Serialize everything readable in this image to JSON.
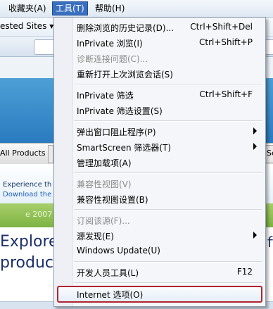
{
  "menubar": {
    "items": [
      {
        "label": "收藏夹(A)"
      },
      {
        "label": "工具(T)"
      },
      {
        "label": "帮助(H)"
      }
    ]
  },
  "background": {
    "favorites_text": "ested Sites ▾",
    "nav_all_products": "All Products",
    "nav_se": "Se",
    "experience_text": "Experience th",
    "download_text": "Download the fr",
    "year_text": "e 2007",
    "explore_text": "Explore",
    "product_text": "produc",
    "right_text": "ft"
  },
  "menu": {
    "items": [
      {
        "label": "删除浏览的历史记录(D)...",
        "shortcut": "Ctrl+Shift+Del",
        "disabled": false,
        "submenu": false
      },
      {
        "label": "InPrivate 浏览(I)",
        "shortcut": "Ctrl+Shift+P",
        "disabled": false,
        "submenu": false
      },
      {
        "label": "诊断连接问题(C)...",
        "shortcut": "",
        "disabled": true,
        "submenu": false
      },
      {
        "label": "重新打开上次浏览会话(S)",
        "shortcut": "",
        "disabled": false,
        "submenu": false
      },
      {
        "label": "InPrivate 筛选",
        "shortcut": "Ctrl+Shift+F",
        "disabled": false,
        "submenu": false
      },
      {
        "label": "InPrivate 筛选设置(S)",
        "shortcut": "",
        "disabled": false,
        "submenu": false
      },
      {
        "label": "弹出窗口阻止程序(P)",
        "shortcut": "",
        "disabled": false,
        "submenu": true
      },
      {
        "label": "SmartScreen 筛选器(T)",
        "shortcut": "",
        "disabled": false,
        "submenu": true
      },
      {
        "label": "管理加载项(A)",
        "shortcut": "",
        "disabled": false,
        "submenu": false
      },
      {
        "label": "兼容性视图(V)",
        "shortcut": "",
        "disabled": true,
        "submenu": false
      },
      {
        "label": "兼容性视图设置(B)",
        "shortcut": "",
        "disabled": false,
        "submenu": false
      },
      {
        "label": "订阅该源(F)...",
        "shortcut": "",
        "disabled": true,
        "submenu": false
      },
      {
        "label": "源发现(E)",
        "shortcut": "",
        "disabled": false,
        "submenu": true
      },
      {
        "label": "Windows Update(U)",
        "shortcut": "",
        "disabled": false,
        "submenu": false
      },
      {
        "label": "开发人员工具(L)",
        "shortcut": "F12",
        "disabled": false,
        "submenu": false
      },
      {
        "label": "Internet 选项(O)",
        "shortcut": "",
        "disabled": false,
        "submenu": false,
        "highlighted": true
      }
    ]
  }
}
